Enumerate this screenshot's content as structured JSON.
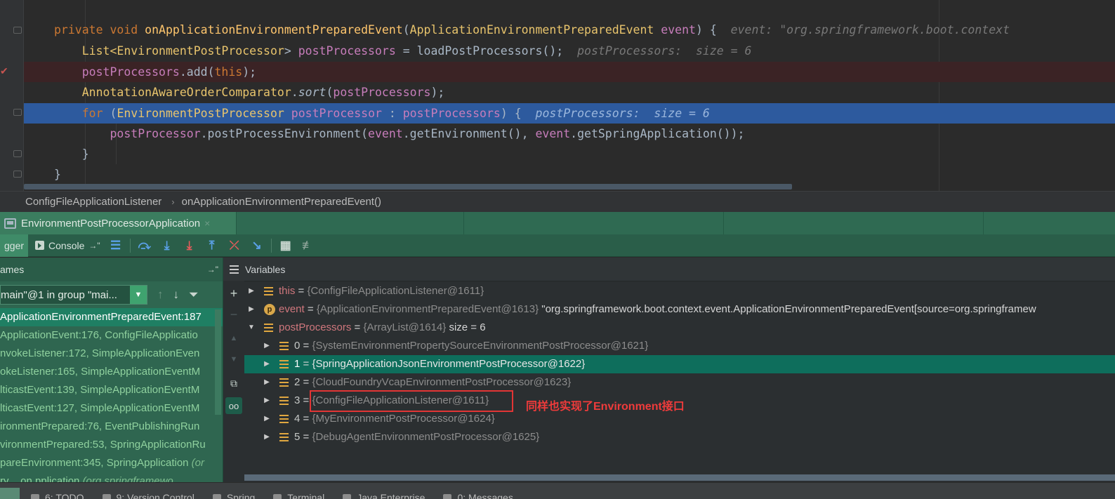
{
  "editor": {
    "lines": [
      {
        "id": "l1"
      },
      {
        "id": "l2"
      }
    ],
    "code": {
      "l1_private": "private",
      "l1_void": "void",
      "l1_method": "onApplicationEnvironmentPreparedEvent",
      "l1_open": "(",
      "l1_type": "ApplicationEnvironmentPreparedEvent",
      "l1_param": "event",
      "l1_close": ") {",
      "l1_hint": "event: \"org.springframework.boot.context",
      "l2_list": "List<",
      "l2_type": "EnvironmentPostProcessor",
      "l2_gt": "> ",
      "l2_var": "postProcessors",
      "l2_rest": " = loadPostProcessors();",
      "l2_hint": "postProcessors:  size = 6",
      "l3_var": "postProcessors",
      "l3_add": ".add(",
      "l3_this": "this",
      "l3_end": ");",
      "l4_cls": "AnnotationAwareOrderComparator",
      "l4_dot": ".",
      "l4_sort": "sort",
      "l4_open": "(",
      "l4_var": "postProcessors",
      "l4_end": ");",
      "l5_for": "for",
      "l5_open": " (",
      "l5_type": "EnvironmentPostProcessor",
      "l5_var": "postProcessor",
      "l5_colon": " : ",
      "l5_coll": "postProcessors",
      "l5_end": ") {",
      "l5_hint": "postProcessors:  size = 6",
      "l6_var": "postProcessor",
      "l6_call": ".postProcessEnvironment(",
      "l6_ev1": "event",
      "l6_mid": ".getEnvironment(), ",
      "l6_ev2": "event",
      "l6_end": ".getSpringApplication());",
      "l7": "}",
      "l8": "}"
    }
  },
  "breadcrumb": {
    "class": "ConfigFileApplicationListener",
    "separator": "›",
    "method": "onApplicationEnvironmentPreparedEvent()"
  },
  "run_tab": {
    "label": "EnvironmentPostProcessorApplication",
    "close": "×"
  },
  "toolbar": {
    "debugger": "gger",
    "console": "Console",
    "pin": "→\""
  },
  "frames": {
    "header": "ames",
    "pin": "→\"",
    "thread": "main\"@1 in group \"mai...",
    "items": [
      {
        "text": "ApplicationEnvironmentPreparedEvent:187",
        "lib": "",
        "selected": true
      },
      {
        "text": "ApplicationEvent:176, ConfigFileApplicatio",
        "lib": "",
        "selected": false
      },
      {
        "text": "nvokeListener:172, SimpleApplicationEven",
        "lib": "",
        "selected": false
      },
      {
        "text": "okeListener:165, SimpleApplicationEventM",
        "lib": "",
        "selected": false
      },
      {
        "text": "lticastEvent:139, SimpleApplicationEventM",
        "lib": "",
        "selected": false
      },
      {
        "text": "lticastEvent:127, SimpleApplicationEventM",
        "lib": "",
        "selected": false
      },
      {
        "text": "ironmentPrepared:76, EventPublishingRun",
        "lib": "",
        "selected": false
      },
      {
        "text": "vironmentPrepared:53, SpringApplicationRu",
        "lib": "",
        "selected": false
      },
      {
        "text": "pareEnvironment:345, SpringApplication ",
        "lib": "(or",
        "selected": false
      },
      {
        "text": "ry ...on  pplication ",
        "lib": "(org.springframewo",
        "selected": false
      }
    ]
  },
  "variables": {
    "header": "Variables",
    "rows": [
      {
        "name": "this",
        "eq": " = ",
        "type": "{ConfigFileApplicationListener@1611}",
        "value": ""
      },
      {
        "name": "event",
        "eq": " = ",
        "type": "{ApplicationEnvironmentPreparedEvent@1613}",
        "value": " \"org.springframework.boot.context.event.ApplicationEnvironmentPreparedEvent[source=org.springframew"
      },
      {
        "name": "postProcessors",
        "eq": " = ",
        "type": "{ArrayList@1614}",
        "value": "  size = 6"
      },
      {
        "name": "0",
        "eq": " = ",
        "type": "{SystemEnvironmentPropertySourceEnvironmentPostProcessor@1621}",
        "value": ""
      },
      {
        "name": "1",
        "eq": " = ",
        "type": "{SpringApplicationJsonEnvironmentPostProcessor@1622}",
        "value": ""
      },
      {
        "name": "2",
        "eq": " = ",
        "type": "{CloudFoundryVcapEnvironmentPostProcessor@1623}",
        "value": ""
      },
      {
        "name": "3",
        "eq": " = ",
        "type": "{ConfigFileApplicationListener@1611}",
        "value": ""
      },
      {
        "name": "4",
        "eq": " = ",
        "type": "{MyEnvironmentPostProcessor@1624}",
        "value": ""
      },
      {
        "name": "5",
        "eq": " = ",
        "type": "{DebugAgentEnvironmentPostProcessor@1625}",
        "value": ""
      }
    ],
    "annotation": "同样也实现了Environment接口"
  },
  "bottom_tabs": [
    {
      "label": "6: TODO"
    },
    {
      "label": "9: Version Control"
    },
    {
      "label": "Spring"
    },
    {
      "label": "Terminal"
    },
    {
      "label": "Java Enterprise"
    },
    {
      "label": "0: Messages"
    }
  ],
  "colors": {
    "execution_line": "#2d5a9e",
    "error_line": "#3b2325",
    "selected_var": "#0e6e5c",
    "annotation": "#ef3b3b"
  }
}
